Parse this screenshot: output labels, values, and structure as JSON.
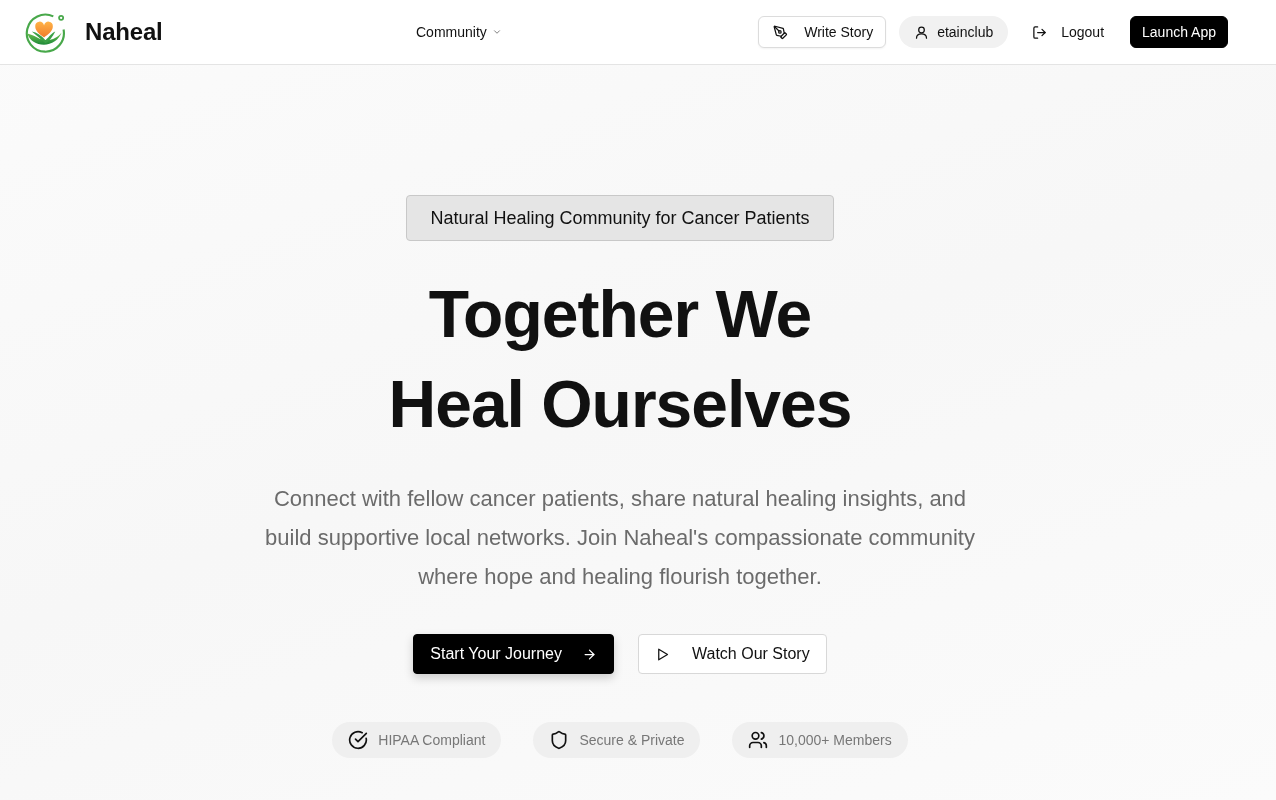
{
  "header": {
    "brand": "Naheal",
    "nav": [
      {
        "label": "Community",
        "kind": "dropdown"
      }
    ],
    "actions": [
      {
        "label": "Write Story",
        "kind": "outline"
      },
      {
        "label": "etainclub",
        "kind": "user"
      },
      {
        "label": "Logout",
        "kind": "logout"
      },
      {
        "label": "Launch App",
        "kind": "primary"
      }
    ]
  },
  "hero": {
    "badge": "Natural Healing Community for Cancer Patients",
    "title_lines": [
      "Together We",
      "Heal Ourselves"
    ],
    "description": "Connect with fellow cancer patients, share natural healing insights, and build supportive local networks. Join Naheal's compassionate community where hope and healing flourish together.",
    "buttons": [
      {
        "label": "Start Your Journey",
        "kind": "primary"
      },
      {
        "label": "Watch Our Story",
        "kind": "outline"
      }
    ],
    "features": [
      {
        "label": "HIPAA Compliant",
        "kind": "check"
      },
      {
        "label": "Secure & Private",
        "kind": "shield"
      },
      {
        "label": "10,000+ Members",
        "kind": "users"
      }
    ]
  }
}
